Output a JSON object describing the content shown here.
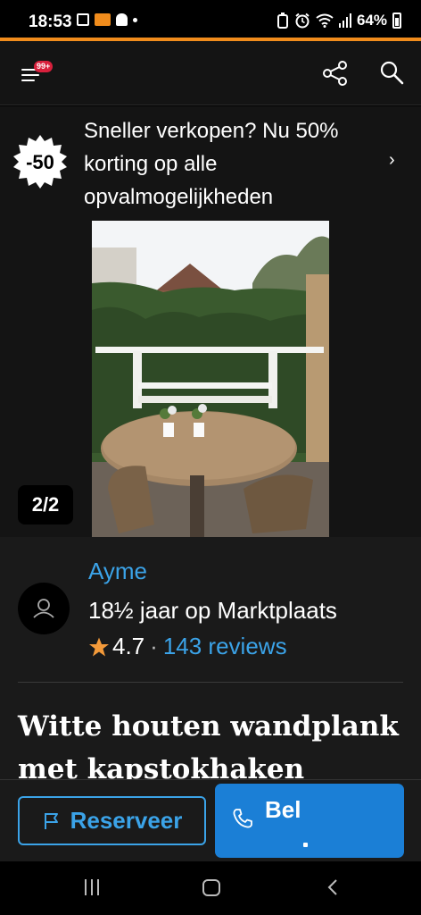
{
  "status_bar": {
    "time": "18:53",
    "battery": "64%",
    "notification_icons": [
      "gallery-icon",
      "app-notification-icon",
      "snapchat-icon",
      "more-dot-icon"
    ],
    "system_icons": [
      "battery-saver-icon",
      "alarm-icon",
      "wifi-icon",
      "signal-icon",
      "battery-icon"
    ]
  },
  "colors": {
    "accent_orange": "#f08c1c",
    "link_blue": "#3ba3e8",
    "call_button_blue": "#1b7fd6",
    "badge_red": "#d8203c",
    "star_orange": "#f39a3a"
  },
  "top_bar": {
    "menu_badge": "99+",
    "icons": [
      "menu-icon",
      "share-icon",
      "search-icon"
    ]
  },
  "promo": {
    "badge": "-50",
    "text": "Sneller verkopen? Nu 50% korting op alle opvalmogelijkheden",
    "chevron": "›"
  },
  "gallery": {
    "counter": "2/2"
  },
  "seller": {
    "name": "Ayme",
    "membership": "18½ jaar op Marktplaats",
    "rating": "4.7",
    "separator": "·",
    "reviews": "143 reviews"
  },
  "listing": {
    "title": "Witte houten wandplank met kapstokhaken"
  },
  "actions": {
    "reserve_label": "Reserveer",
    "call_label": "Bel"
  },
  "system_nav": {
    "icons": [
      "recents-icon",
      "home-icon",
      "back-icon"
    ]
  }
}
